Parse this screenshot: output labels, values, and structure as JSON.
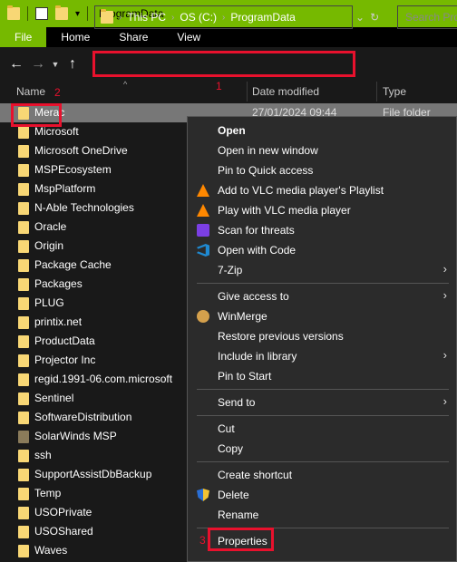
{
  "titlebar": {
    "title": "ProgramData"
  },
  "ribbon": {
    "tabs": [
      "File",
      "Home",
      "Share",
      "View"
    ]
  },
  "address": {
    "crumbs": [
      "This PC",
      "OS (C:)",
      "ProgramData"
    ],
    "search_placeholder": "Search Pro"
  },
  "columns": {
    "name": "Name",
    "date": "Date modified",
    "type": "Type"
  },
  "files": [
    {
      "name": "Merac",
      "date": "27/01/2024 09:44",
      "type": "File folder"
    },
    {
      "name": "Microsoft"
    },
    {
      "name": "Microsoft OneDrive"
    },
    {
      "name": "MSPEcosystem"
    },
    {
      "name": "MspPlatform"
    },
    {
      "name": "N-Able Technologies"
    },
    {
      "name": "Oracle"
    },
    {
      "name": "Origin"
    },
    {
      "name": "Package Cache"
    },
    {
      "name": "Packages"
    },
    {
      "name": "PLUG"
    },
    {
      "name": "printix.net"
    },
    {
      "name": "ProductData"
    },
    {
      "name": "Projector Inc"
    },
    {
      "name": "regid.1991-06.com.microsoft"
    },
    {
      "name": "Sentinel"
    },
    {
      "name": "SoftwareDistribution"
    },
    {
      "name": "SolarWinds MSP"
    },
    {
      "name": "ssh"
    },
    {
      "name": "SupportAssistDbBackup"
    },
    {
      "name": "Temp"
    },
    {
      "name": "USOPrivate"
    },
    {
      "name": "USOShared"
    },
    {
      "name": "Waves"
    }
  ],
  "context_menu": {
    "open": "Open",
    "open_new_window": "Open in new window",
    "pin_quick_access": "Pin to Quick access",
    "vlc_playlist": "Add to VLC media player's Playlist",
    "vlc_play": "Play with VLC media player",
    "scan_threats": "Scan for threats",
    "open_with_code": "Open with Code",
    "seven_zip": "7-Zip",
    "give_access": "Give access to",
    "winmerge": "WinMerge",
    "restore_versions": "Restore previous versions",
    "include_library": "Include in library",
    "pin_start": "Pin to Start",
    "send_to": "Send to",
    "cut": "Cut",
    "copy": "Copy",
    "create_shortcut": "Create shortcut",
    "delete": "Delete",
    "rename": "Rename",
    "properties": "Properties"
  },
  "annotations": {
    "one": "1",
    "two": "2",
    "three": "3"
  },
  "colors": {
    "accent": "#76b900",
    "highlight": "#e8112d",
    "selection": "#777777"
  }
}
